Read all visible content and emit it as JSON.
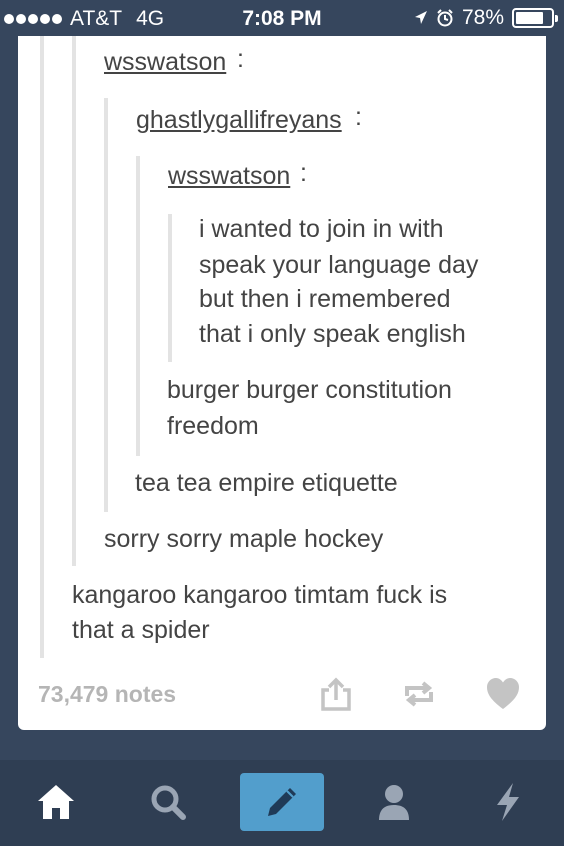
{
  "status_bar": {
    "carrier": "AT&T",
    "network": "4G",
    "time": "7:08 PM",
    "battery": "78%",
    "battery_level": 0.78
  },
  "post": {
    "users": {
      "level1": "wsswatson",
      "level2": "ghastlygallifreyans",
      "level3": "wsswatson"
    },
    "colon": ":",
    "quote_lines": [
      "i wanted to join in with",
      "speak your language day",
      "but then i remembered",
      "that i only speak english"
    ],
    "reply3_lines": [
      "burger burger constitution",
      "freedom"
    ],
    "reply2": "tea tea empire etiquette",
    "reply1": "sorry sorry maple hockey",
    "reply0_lines": [
      "kangaroo kangaroo timtam fuck is",
      "that a spider"
    ],
    "notes": "73,479 notes"
  },
  "tabbar": {
    "tabs": [
      "home",
      "search",
      "compose",
      "account",
      "activity"
    ]
  },
  "colors": {
    "background": "#36465d",
    "accent": "#529ecc",
    "text": "#444444",
    "icon_gray": "#c4c4c4"
  }
}
